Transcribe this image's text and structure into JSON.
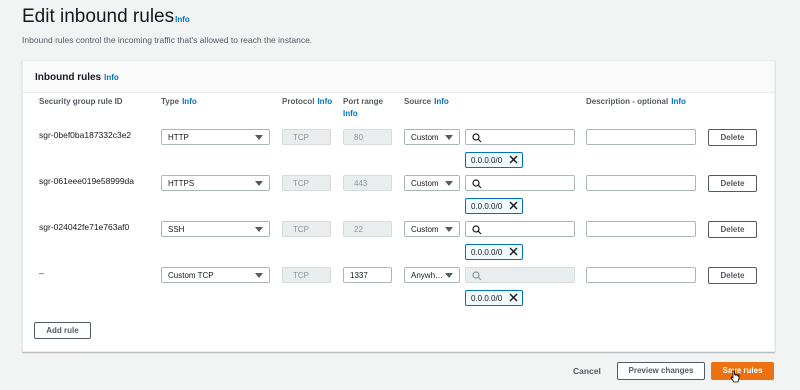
{
  "page": {
    "title": "Edit inbound rules",
    "title_info": "Info",
    "description": "Inbound rules control the incoming traffic that's allowed to reach the instance."
  },
  "panel": {
    "title": "Inbound rules",
    "title_info": "Info"
  },
  "columns": {
    "rule_id": "Security group rule ID",
    "type": "Type",
    "type_info": "Info",
    "protocol": "Protocol",
    "protocol_info": "Info",
    "port_range": "Port range",
    "port_range_info": "Info",
    "source": "Source",
    "source_info": "Info",
    "description": "Description - optional",
    "description_info": "Info"
  },
  "rules": [
    {
      "id": "sgr-0bef0ba187332c3e2",
      "type": "HTTP",
      "protocol": "TCP",
      "port": "80",
      "source": "Custom",
      "cidr": "0.0.0.0/0",
      "description": "",
      "delete": "Delete"
    },
    {
      "id": "sgr-061eee019e58999da",
      "type": "HTTPS",
      "protocol": "TCP",
      "port": "443",
      "source": "Custom",
      "cidr": "0.0.0.0/0",
      "description": "",
      "delete": "Delete"
    },
    {
      "id": "sgr-024042fe71e763af0",
      "type": "SSH",
      "protocol": "TCP",
      "port": "22",
      "source": "Custom",
      "cidr": "0.0.0.0/0",
      "description": "",
      "delete": "Delete"
    },
    {
      "id": "–",
      "type": "Custom TCP",
      "protocol": "TCP",
      "port": "1337",
      "source": "Anywh…",
      "cidr": "0.0.0.0/0",
      "description": "",
      "delete": "Delete"
    }
  ],
  "actions": {
    "add_rule": "Add rule",
    "cancel": "Cancel",
    "preview": "Preview changes",
    "save": "Save rules"
  },
  "colors": {
    "primary": "#ec7211",
    "link": "#0073bb",
    "token_border": "#0073bb"
  }
}
